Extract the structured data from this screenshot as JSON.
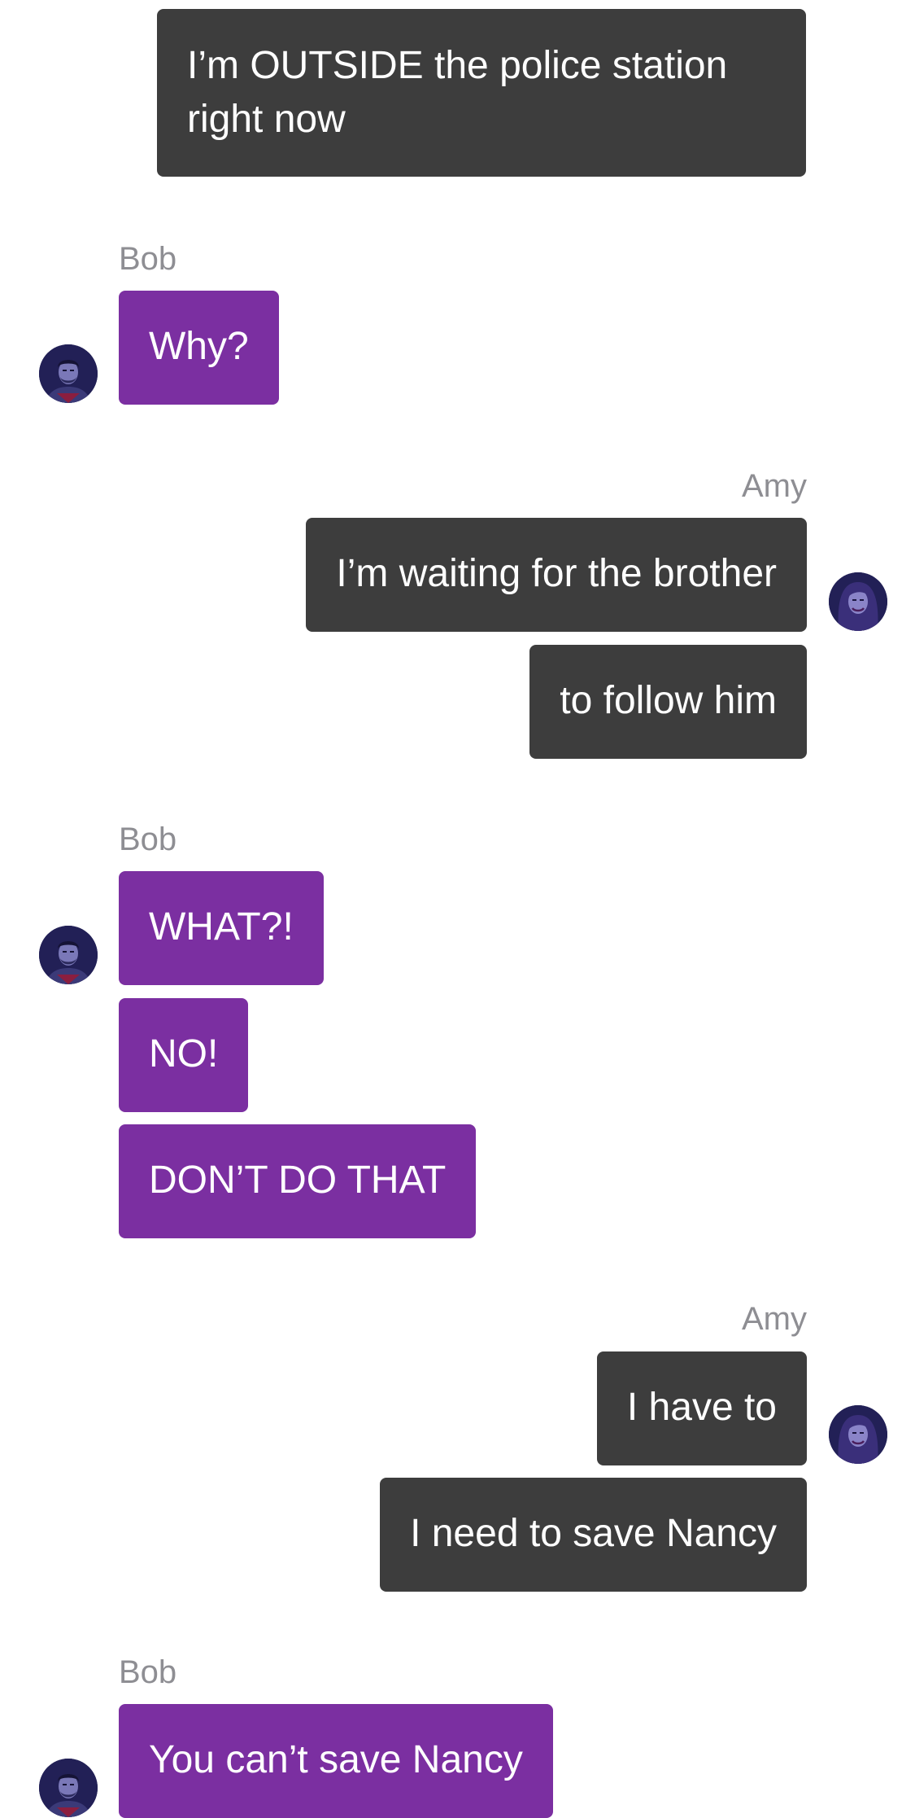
{
  "colors": {
    "sent_bubble": "#3d3d3d",
    "received_bubble": "#7b2fa1",
    "sender_label": "#8e8e93",
    "background": "#ffffff"
  },
  "messages": [
    {
      "text": "I’m OUTSIDE the police station right now",
      "direction": "sent"
    },
    {
      "sender": "Bob",
      "text": "Why?",
      "direction": "received"
    },
    {
      "sender": "Amy",
      "text": "I’m waiting for the brother",
      "direction": "sent"
    },
    {
      "text": "to follow him",
      "direction": "sent"
    },
    {
      "sender": "Bob",
      "text": "WHAT?!",
      "direction": "received"
    },
    {
      "text": "NO!",
      "direction": "received"
    },
    {
      "text": "DON’T DO THAT",
      "direction": "received"
    },
    {
      "sender": "Amy",
      "text": "I have to",
      "direction": "sent"
    },
    {
      "text": "I need to save Nancy",
      "direction": "sent"
    },
    {
      "sender": "Bob",
      "text": "You can’t save Nancy",
      "direction": "received"
    }
  ],
  "avatars": {
    "bob": "male-avatar-icon",
    "amy": "female-avatar-icon"
  }
}
